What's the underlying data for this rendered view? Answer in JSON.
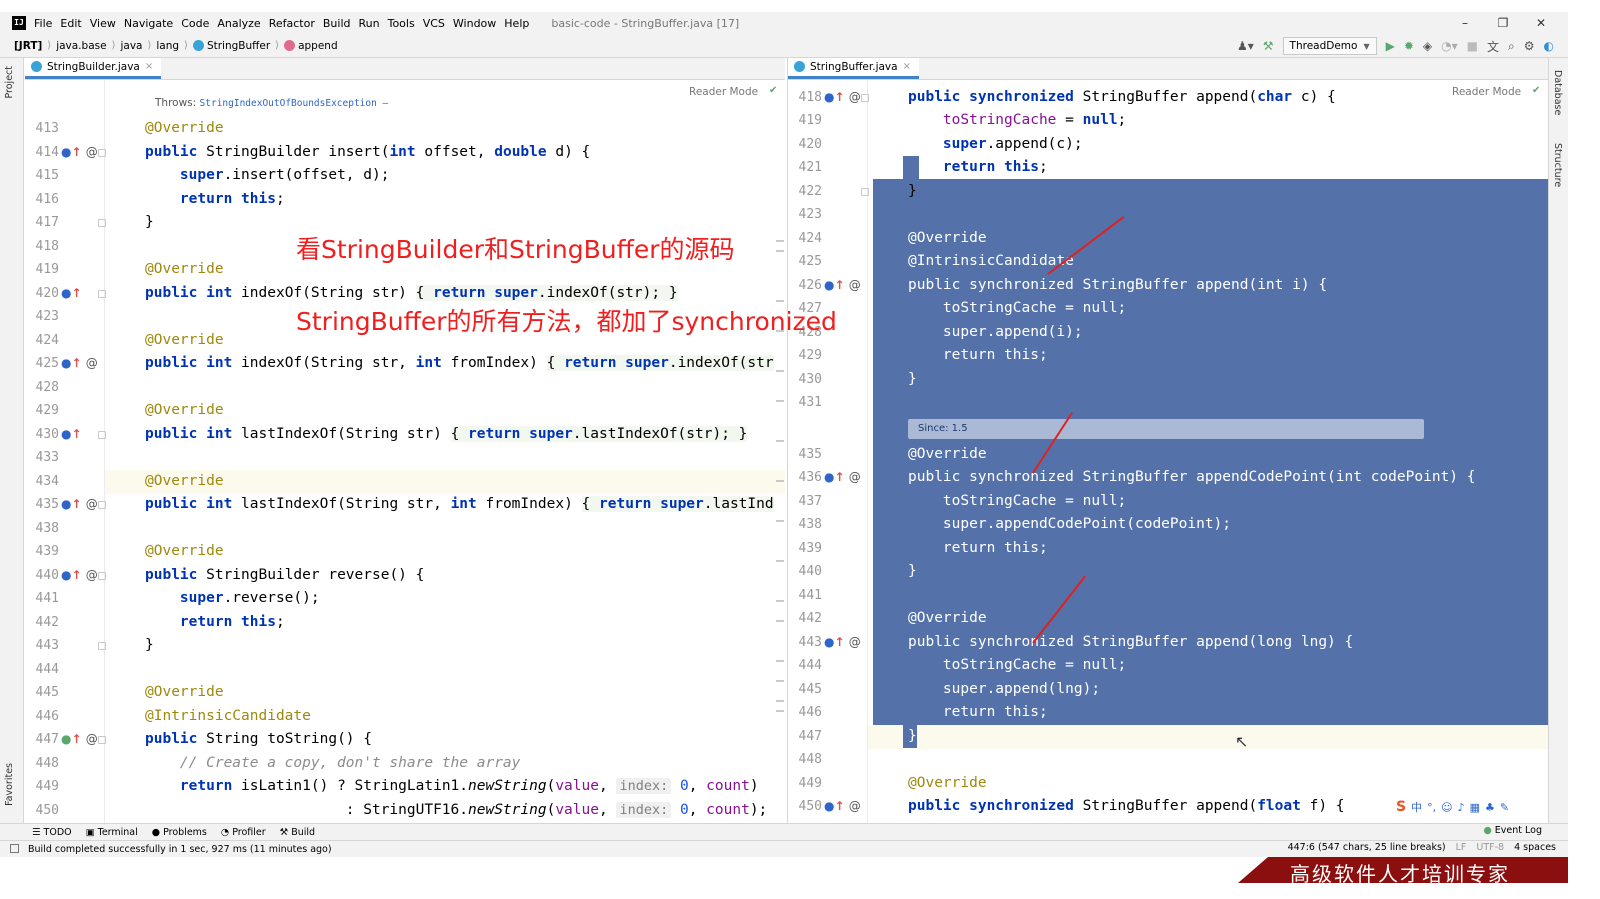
{
  "menubar": {
    "logo": "IJ",
    "items": [
      "File",
      "Edit",
      "View",
      "Navigate",
      "Code",
      "Analyze",
      "Refactor",
      "Build",
      "Run",
      "Tools",
      "VCS",
      "Window",
      "Help"
    ],
    "title": "basic-code - StringBuffer.java [17]",
    "minimize": "–",
    "restore": "❐",
    "close": "✕"
  },
  "navbar": {
    "crumbs": [
      "[JRT]",
      "java.base",
      "java",
      "lang",
      "StringBuffer",
      "append"
    ],
    "run_config": "ThreadDemo"
  },
  "colors": {
    "accent": "#4083c9",
    "selection": "#5472a9",
    "annotation": "#9e880d",
    "keyword": "#0033b3",
    "overlay_red": "#ef1f1f"
  },
  "side": {
    "project": "Project",
    "favorites": "Favorites",
    "database": "Database",
    "structure": "Structure"
  },
  "left_pane": {
    "tab": "StringBuilder.java",
    "reader_mode": "Reader Mode",
    "throws_label": "Throws:",
    "throws_exc": "StringIndexOutOfBoundsException –",
    "lines": [
      "413",
      "414",
      "415",
      "416",
      "417",
      "418",
      "419",
      "420",
      "423",
      "424",
      "425",
      "428",
      "429",
      "430",
      "433",
      "434",
      "435",
      "438",
      "439",
      "440",
      "441",
      "442",
      "443",
      "444",
      "445",
      "446",
      "447",
      "448",
      "449",
      "450"
    ]
  },
  "right_pane": {
    "tab": "StringBuffer.java",
    "reader_mode": "Reader Mode",
    "since": "Since: 1.5",
    "lines": [
      "418",
      "419",
      "420",
      "421",
      "422",
      "423",
      "424",
      "425",
      "426",
      "427",
      "428",
      "429",
      "430",
      "431",
      "435",
      "436",
      "437",
      "438",
      "439",
      "440",
      "441",
      "442",
      "443",
      "444",
      "445",
      "446",
      "447",
      "448",
      "449",
      "450"
    ]
  },
  "overlays": {
    "line1": "看StringBuilder和StringBuffer的源码",
    "line2": "StringBuffer的所有方法，都加了synchronized"
  },
  "bottom_tools": [
    "TODO",
    "Terminal",
    "Problems",
    "Profiler",
    "Build"
  ],
  "event_log": "Event Log",
  "status": {
    "message": "Build completed successfully in 1 sec, 927 ms (11 minutes ago)",
    "position": "447:6 (547 chars, 25 line breaks)",
    "line_sep": "LF",
    "encoding": "UTF-8",
    "indent": "4 spaces"
  },
  "banner": "高级软件人才培训专家"
}
